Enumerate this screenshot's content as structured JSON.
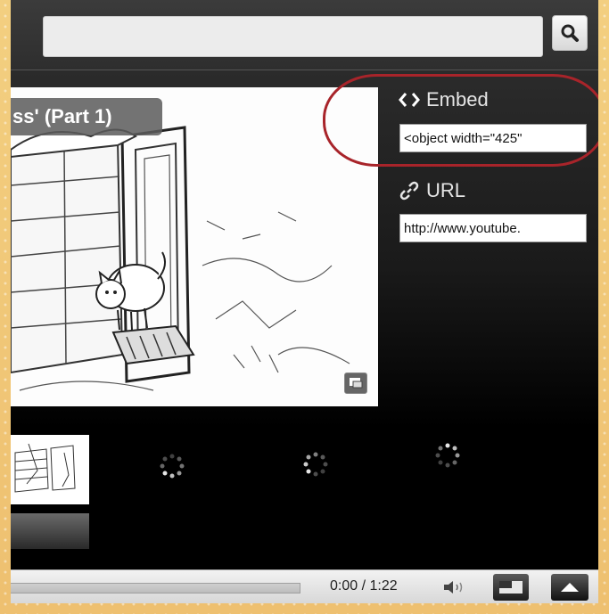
{
  "search": {
    "value": "",
    "placeholder": ""
  },
  "icons": {
    "search": "magnifier-icon",
    "embed": "code-brackets-icon",
    "url": "link-icon",
    "volume": "speaker-icon",
    "size": "player-size-icon",
    "expand": "up-arrow-icon",
    "popout": "popout-icon"
  },
  "video": {
    "title": "ss' (Part 1)"
  },
  "share": {
    "embed_label": "Embed",
    "embed_value": "<object width=\"425\"",
    "url_label": "URL",
    "url_value": "http://www.youtube."
  },
  "controls": {
    "time": "0:00 / 1:22",
    "progress": 0
  },
  "colors": {
    "highlight_circle": "#a8242a",
    "player_bg": "#1a1a1a"
  }
}
